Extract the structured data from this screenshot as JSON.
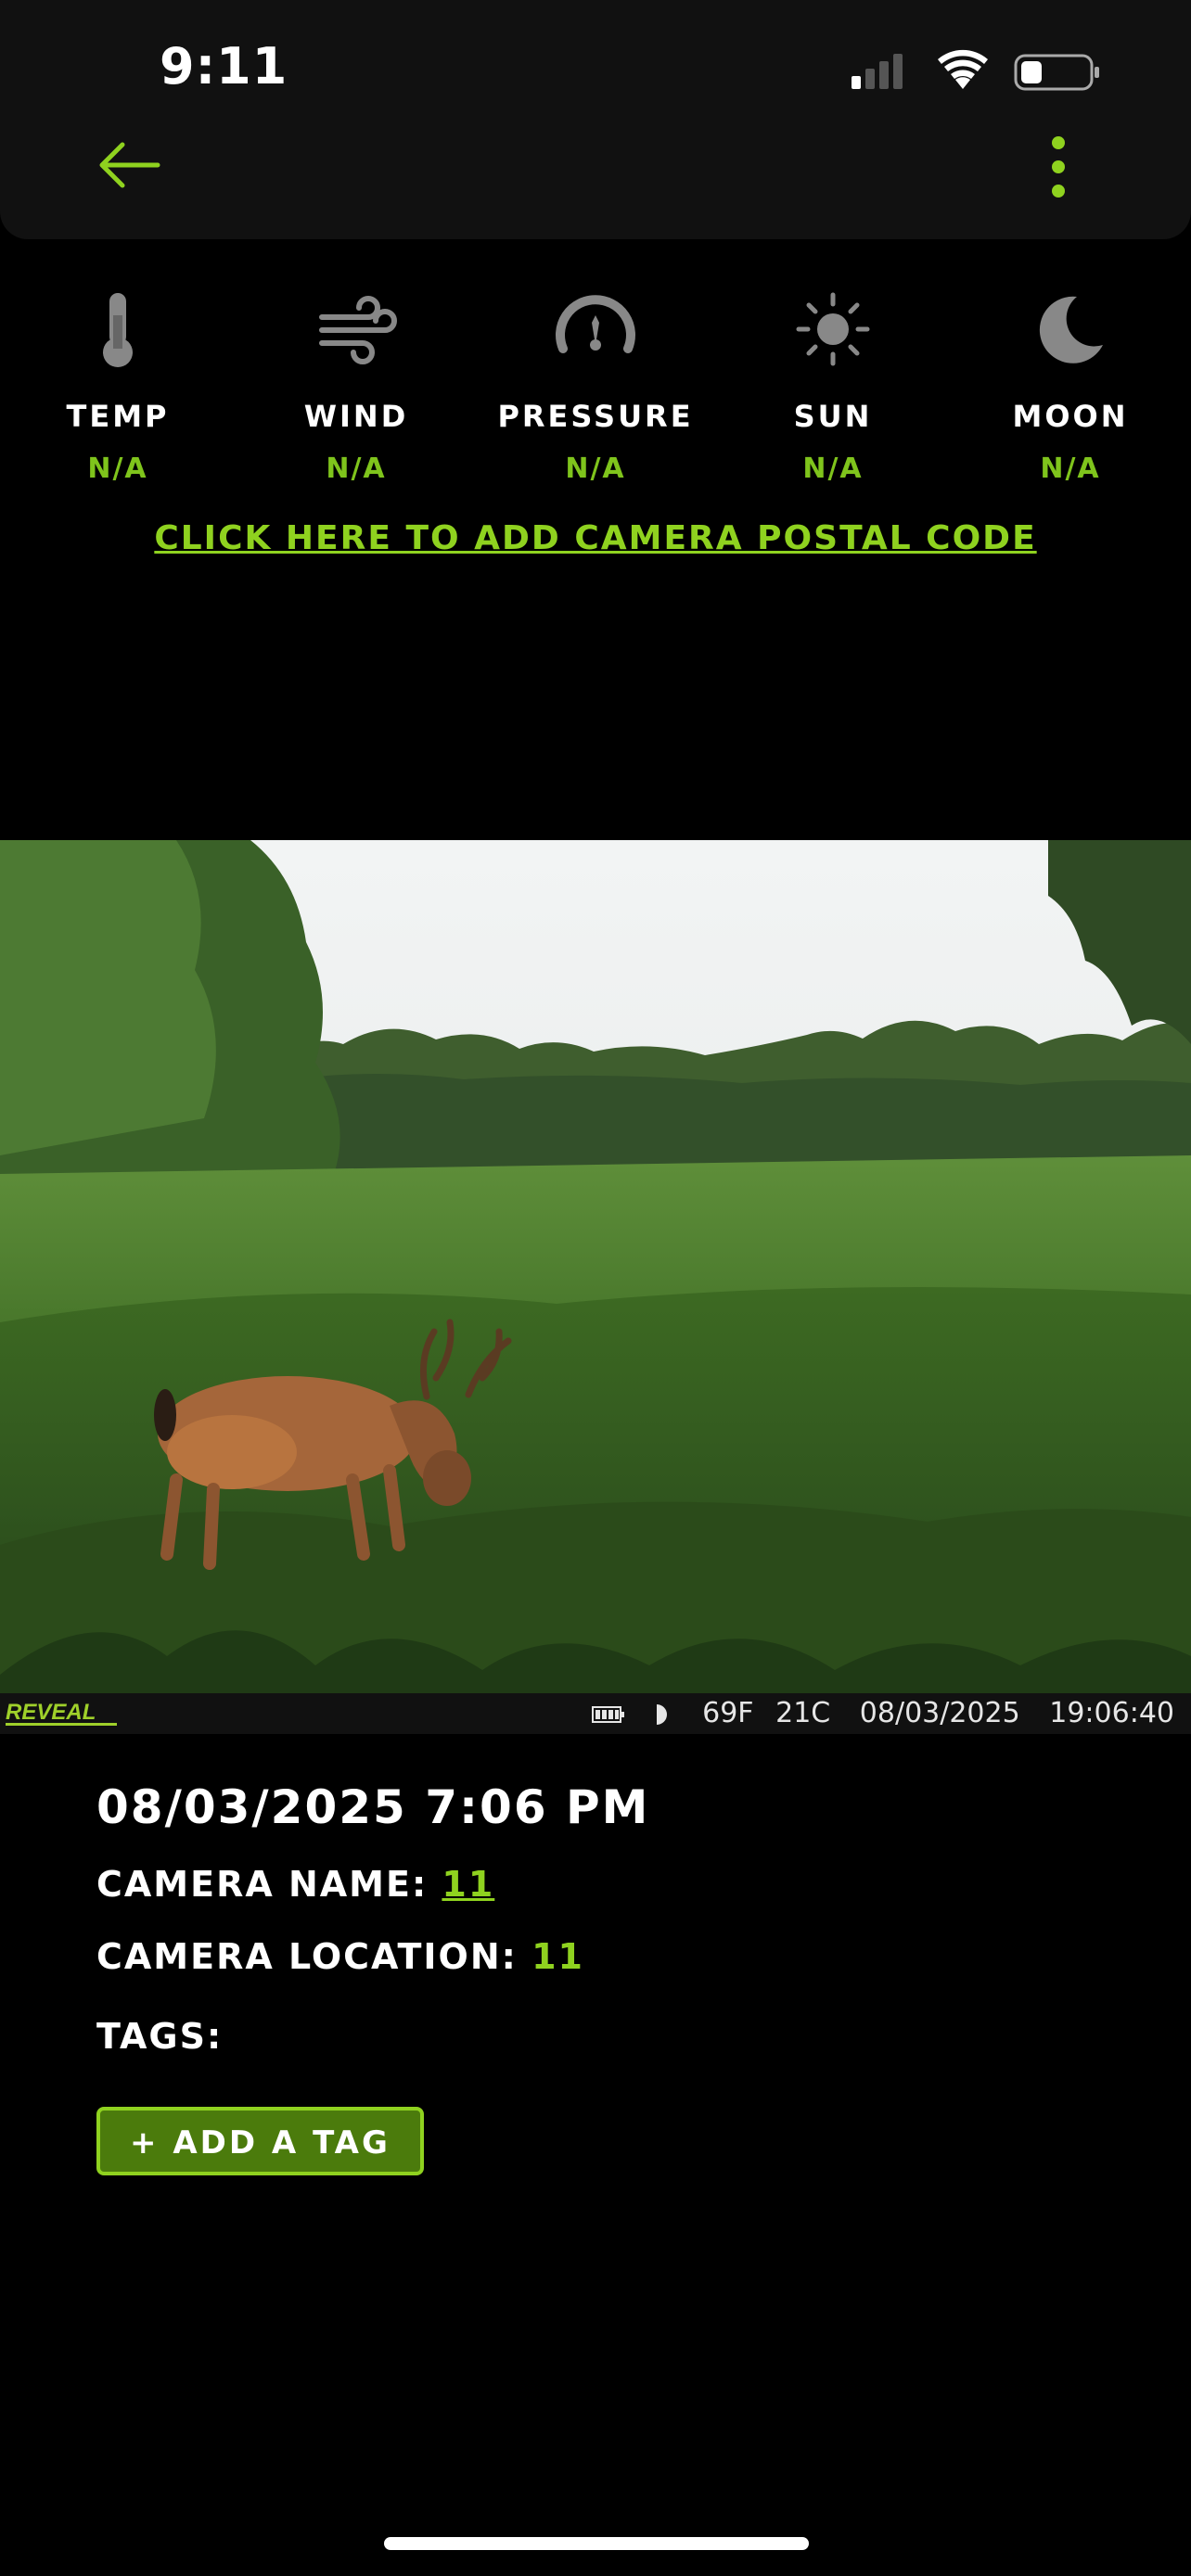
{
  "status_bar": {
    "time": "9:11"
  },
  "weather": [
    {
      "icon": "thermometer-icon",
      "label": "TEMP",
      "value": "N/A"
    },
    {
      "icon": "wind-icon",
      "label": "WIND",
      "value": "N/A"
    },
    {
      "icon": "pressure-gauge-icon",
      "label": "PRESSURE",
      "value": "N/A"
    },
    {
      "icon": "sun-icon",
      "label": "SUN",
      "value": "N/A"
    },
    {
      "icon": "moon-icon",
      "label": "MOON",
      "value": "N/A"
    }
  ],
  "postal_link": "CLICK HERE TO ADD CAMERA POSTAL CODE",
  "photo_stamp": {
    "logo": "REVEAL",
    "temp_f": "69F",
    "temp_c": "21C",
    "date": "08/03/2025",
    "time": "19:06:40"
  },
  "details": {
    "datetime": "08/03/2025 7:06 PM",
    "camera_name_label": "CAMERA NAME: ",
    "camera_name": "11",
    "camera_location_label": "CAMERA LOCATION: ",
    "camera_location": "11",
    "tags_label": "TAGS:",
    "add_tag": "+ ADD A TAG"
  },
  "colors": {
    "accent": "#8fd21f",
    "button_bg": "#4b7b0c",
    "topbar": "#111111"
  }
}
